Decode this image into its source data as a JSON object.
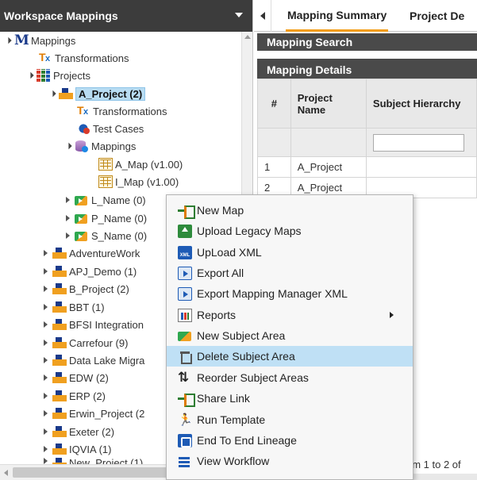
{
  "left_panel": {
    "title": "Workspace Mappings",
    "tree": {
      "root": "Mappings",
      "transformations": "Transformations",
      "projects": "Projects",
      "selected_project": "A_Project (2)",
      "a_transformations": "Transformations",
      "a_test_cases": "Test Cases",
      "a_mappings": "Mappings",
      "a_map": "A_Map (v1.00)",
      "i_map": "I_Map (v1.00)",
      "subject_areas": [
        "L_Name (0)",
        "P_Name (0)",
        "S_Name (0)"
      ],
      "other_projects": [
        "AdventureWork",
        "APJ_Demo (1)",
        "B_Project (2)",
        "BBT (1)",
        "BFSI Integration",
        "Carrefour (9)",
        "Data Lake Migra",
        "EDW (2)",
        "ERP (2)",
        "Erwin_Project (2",
        "Exeter (2)",
        "IQVIA (1)",
        "New_Project (1)"
      ]
    }
  },
  "right_panel": {
    "tabs": [
      "Mapping Summary",
      "Project De"
    ],
    "mapping_search": "Mapping Search",
    "mapping_details": "Mapping Details",
    "table": {
      "headers": [
        "#",
        "Project Name",
        "Subject Hierarchy"
      ],
      "rows": [
        [
          "1",
          "A_Project",
          ""
        ],
        [
          "2",
          "A_Project",
          ""
        ]
      ]
    },
    "footer": "om 1 to 2 of"
  },
  "context_menu": {
    "items": [
      "New Map",
      "Upload Legacy Maps",
      "UpLoad XML",
      "Export All",
      "Export Mapping Manager XML",
      "Reports",
      "New Subject Area",
      "Delete Subject Area",
      "Reorder Subject Areas",
      "Share Link",
      "Run Template",
      "End To End Lineage",
      "View Workflow"
    ],
    "highlighted": "Delete Subject Area"
  }
}
